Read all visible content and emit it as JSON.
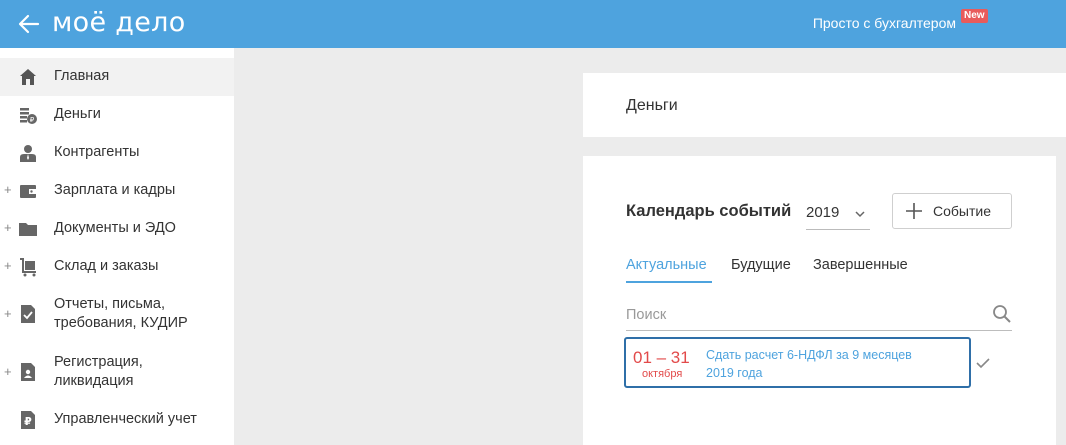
{
  "header": {
    "logo": "моё дело",
    "promo_link": "Просто с бухгалтером",
    "new_badge": "New",
    "back_icon": "arrow-left-icon"
  },
  "sidebar": {
    "items": [
      {
        "label": "Главная",
        "icon": "home-icon",
        "active": true,
        "expandable": false
      },
      {
        "label": "Деньги",
        "icon": "coins-icon",
        "active": false,
        "expandable": false
      },
      {
        "label": "Контрагенты",
        "icon": "person-icon",
        "active": false,
        "expandable": false
      },
      {
        "label": "Зарплата и кадры",
        "icon": "wallet-icon",
        "active": false,
        "expandable": true
      },
      {
        "label": "Документы и ЭДО",
        "icon": "folder-icon",
        "active": false,
        "expandable": true
      },
      {
        "label": "Склад и заказы",
        "icon": "cart-icon",
        "active": false,
        "expandable": true
      },
      {
        "label": "Отчеты, письма,\nтребования, КУДИР",
        "icon": "report-icon",
        "active": false,
        "expandable": true
      },
      {
        "label": "Регистрация,\nликвидация",
        "icon": "registration-icon",
        "active": false,
        "expandable": true
      },
      {
        "label": "Управленческий учет",
        "icon": "ruble-icon",
        "active": false,
        "expandable": false
      }
    ],
    "expand_symbol": "+"
  },
  "money_card": {
    "title": "Деньги"
  },
  "calendar": {
    "title": "Календарь событий",
    "year": "2019",
    "add_event_label": "Событие",
    "tabs": [
      {
        "label": "Актуальные",
        "active": true
      },
      {
        "label": "Будущие",
        "active": false
      },
      {
        "label": "Завершенные",
        "active": false
      }
    ],
    "search_placeholder": "Поиск",
    "events": [
      {
        "date_range": "01 – 31",
        "month": "октября",
        "text": "Сдать расчет 6-НДФЛ за 9 месяцев 2019 года"
      }
    ]
  },
  "colors": {
    "header_bg": "#4ea3de",
    "accent": "#4ea3de",
    "date_red": "#e24a4a",
    "event_border": "#2f6fa8",
    "badge": "#e85b5b"
  }
}
